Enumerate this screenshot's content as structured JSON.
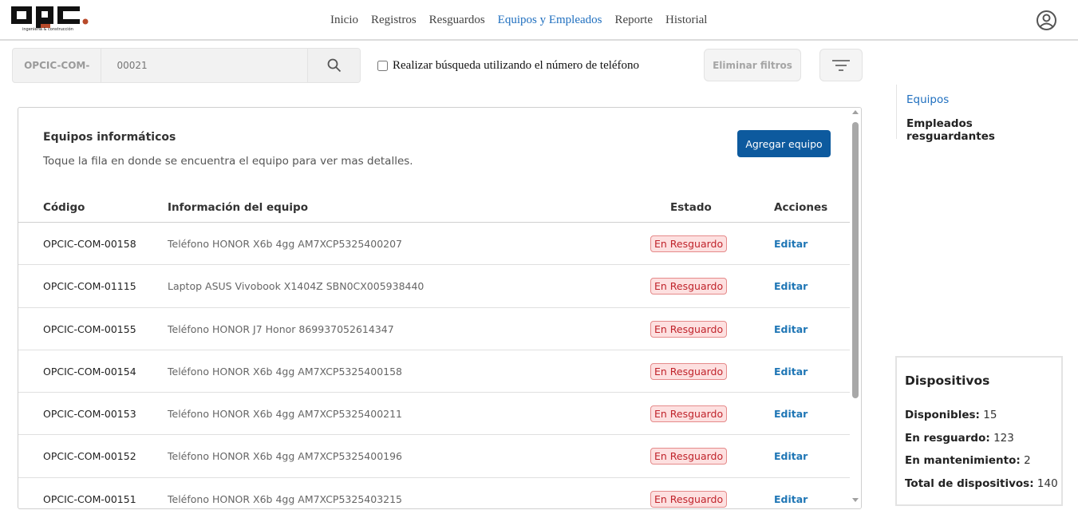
{
  "header": {
    "logo_text": "OPC",
    "logo_tagline": "ingeniería & construcción",
    "nav": [
      {
        "label": "Inicio"
      },
      {
        "label": "Registros"
      },
      {
        "label": "Resguardos"
      },
      {
        "label": "Equipos y Empleados",
        "active": true
      },
      {
        "label": "Reporte"
      },
      {
        "label": "Historial"
      }
    ],
    "user_icon": "user-circle-icon"
  },
  "search": {
    "prefix": "OPCIC-COM-",
    "placeholder": "00021",
    "search_icon": "search-icon",
    "phone_checkbox_label": "Realizar búsqueda utilizando el número de teléfono",
    "phone_checked": false,
    "clear_filters_label": "Eliminar filtros",
    "filter_icon": "filter-icon"
  },
  "card": {
    "title": "Equipos informáticos",
    "subtitle": "Toque la fila en donde se encuentra el equipo para ver mas detalles.",
    "add_button": "Agregar equipo",
    "columns": {
      "code": "Código",
      "info": "Información del equipo",
      "status": "Estado",
      "actions": "Acciones"
    },
    "rows": [
      {
        "code": "OPCIC-COM-00158",
        "info": "Teléfono HONOR X6b 4gg AM7XCP5325400207",
        "status": "En Resguardo",
        "action": "Editar"
      },
      {
        "code": "OPCIC-COM-01115",
        "info": "Laptop ASUS Vivobook X1404Z SBN0CX005938440",
        "status": "En Resguardo",
        "action": "Editar"
      },
      {
        "code": "OPCIC-COM-00155",
        "info": "Teléfono HONOR J7 Honor 869937052614347",
        "status": "En Resguardo",
        "action": "Editar"
      },
      {
        "code": "OPCIC-COM-00154",
        "info": "Teléfono HONOR X6b 4gg AM7XCP5325400158",
        "status": "En Resguardo",
        "action": "Editar"
      },
      {
        "code": "OPCIC-COM-00153",
        "info": "Teléfono HONOR X6b 4gg AM7XCP5325400211",
        "status": "En Resguardo",
        "action": "Editar"
      },
      {
        "code": "OPCIC-COM-00152",
        "info": "Teléfono HONOR X6b 4gg AM7XCP5325400196",
        "status": "En Resguardo",
        "action": "Editar"
      },
      {
        "code": "OPCIC-COM-00151",
        "info": "Teléfono HONOR X6b 4gg AM7XCP5325403215",
        "status": "En Resguardo",
        "action": "Editar"
      }
    ]
  },
  "side_nav": {
    "items": [
      {
        "label": "Equipos",
        "active": true
      },
      {
        "label": "Empleados resguardantes",
        "active": false
      }
    ]
  },
  "devices": {
    "title": "Dispositivos",
    "available_label": "Disponibles:",
    "available_value": "15",
    "in_custody_label": "En resguardo:",
    "in_custody_value": "123",
    "maintenance_label": "En mantenimiento:",
    "maintenance_value": "2",
    "total_label": "Total de dispositivos:",
    "total_value": "140"
  },
  "colors": {
    "accent": "#1f6fbf",
    "primary_button": "#0d5a9e",
    "badge_bg": "#fde0e0",
    "badge_text": "#c0232b",
    "logo_dot": "#b84a2a"
  }
}
